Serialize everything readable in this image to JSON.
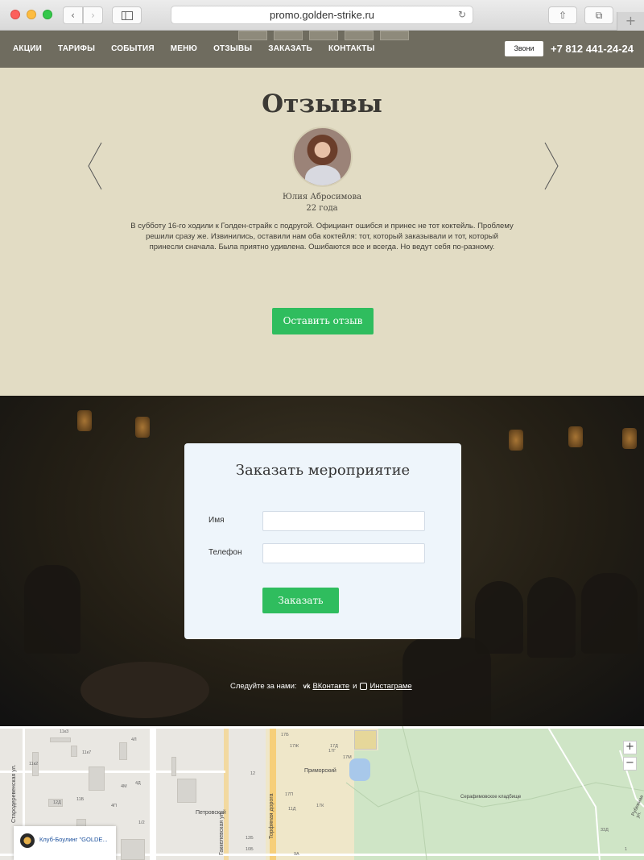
{
  "browser": {
    "url": "promo.golden-strike.ru",
    "back_icon": "‹",
    "forward_icon": "›",
    "reload_icon": "↻",
    "share_icon": "⇧",
    "tabs_icon": "⧉",
    "newtab_icon": "+"
  },
  "nav": {
    "items": [
      "АКЦИИ",
      "ТАРИФЫ",
      "СОБЫТИЯ",
      "МЕНЮ",
      "ОТЗЫВЫ",
      "ЗАКАЗАТЬ",
      "КОНТАКТЫ"
    ],
    "call_label": "Звони",
    "phone": "+7 812 441-24-24"
  },
  "reviews": {
    "title": "Отзывы",
    "name": "Юлия Абросимова",
    "age": "22 года",
    "text": "В субботу 16-го ходили к Голден-страйк с подругой. Официант ошибся и принес не тот коктейль. Проблему решили сразу же. Извинились, оставили нам оба коктейля: тот, который заказывали и тот, который принесли сначала. Была приятно удивлена. Ошибаются все и всегда. Но ведут себя по-разному.",
    "leave_button": "Оставить отзыв"
  },
  "order": {
    "title": "Заказать мероприятие",
    "name_label": "Имя",
    "phone_label": "Телефон",
    "name_value": "",
    "phone_value": "",
    "submit": "Заказать"
  },
  "social": {
    "follow": "Следуйте за нами:",
    "vk_icon": "vk",
    "vk": "ВКонтакте",
    "and": "и",
    "instagram": "Инстаграме"
  },
  "map": {
    "street_1": "Стародеревенская ул.",
    "street_2": "Гаккелевская ул.",
    "street_3": "Торфяная дорога",
    "place_primorsky": "Приморский",
    "place_petrovsky": "Петровский",
    "place_cemetery": "Серафимовское кладбище",
    "street_rubezhnaya": "Рубежная ул.",
    "zoom_in": "+",
    "zoom_out": "−",
    "card_title": "Клуб-Боулинг \"GOLDE...",
    "building_numbers": [
      "11к3",
      "11к7",
      "4Л",
      "11к2",
      "4М",
      "4Д",
      "12Д",
      "11Б",
      "4П",
      "1/2",
      "17Б",
      "17Ж",
      "17Д",
      "17Г",
      "17М",
      "17П",
      "17К",
      "11Д",
      "12Б",
      "12",
      "10Б",
      "9А",
      "33Д",
      "1"
    ]
  },
  "colors": {
    "nav_bg": "#6f6c5f",
    "reviews_bg": "#e2dcc4",
    "accent_green": "#2fbd5e",
    "modal_bg": "#eef5fb"
  }
}
